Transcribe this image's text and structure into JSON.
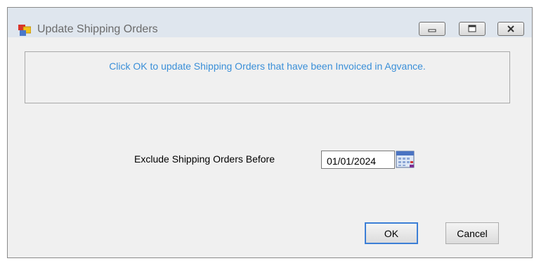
{
  "window": {
    "title": "Update Shipping Orders",
    "controls": {
      "minimize": "minimize-icon",
      "restore": "restore-icon",
      "close": "close-icon"
    }
  },
  "info": {
    "message": "Click OK to update Shipping Orders that have been Invoiced in Agvance."
  },
  "form": {
    "exclude_label": "Exclude Shipping Orders Before",
    "date_value": "01/01/2024"
  },
  "buttons": {
    "ok": "OK",
    "cancel": "Cancel"
  },
  "colors": {
    "info_text": "#3a8fd8",
    "ok_focus_border": "#3c7fd6",
    "titlebar": "#dfe6ee",
    "dialog_bg": "#f0f0f0"
  }
}
